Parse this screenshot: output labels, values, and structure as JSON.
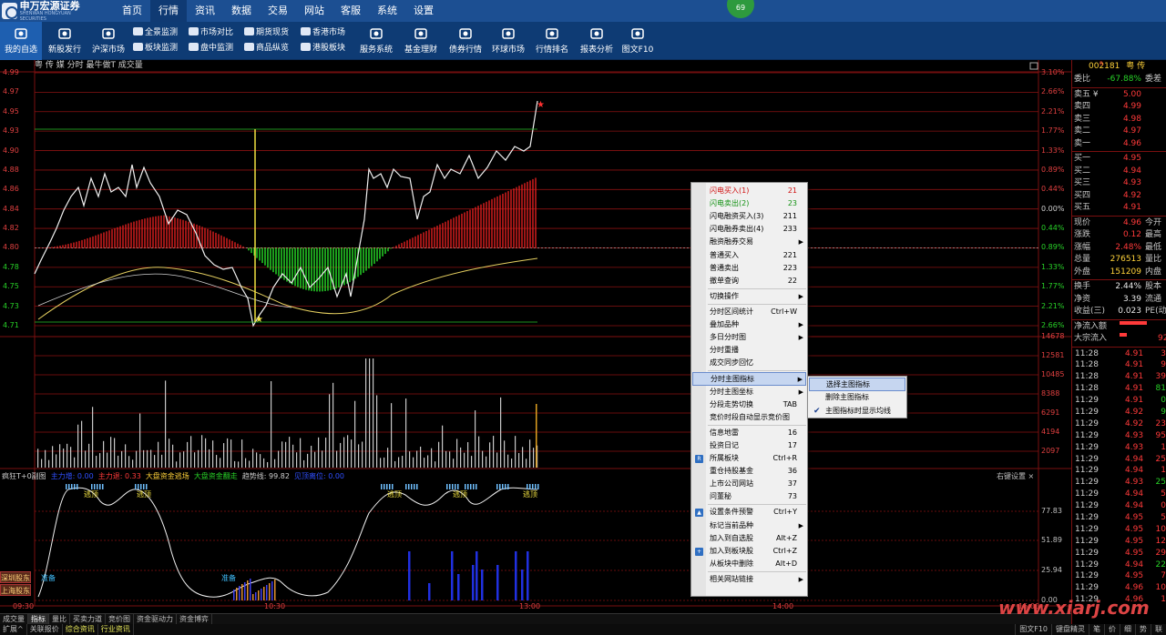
{
  "app": {
    "logo_text": "申万宏源证券",
    "logo_sub": "SHENWAN HONGYUAN SECURITIES",
    "notification_count": "69"
  },
  "menu": [
    "首页",
    "行情",
    "资讯",
    "数据",
    "交易",
    "网站",
    "客服",
    "系统",
    "设置"
  ],
  "menu_active": "行情",
  "toolbar": {
    "big": [
      {
        "label": "我的自选",
        "icon": "favorites-icon"
      },
      {
        "label": "新股发行",
        "icon": "compass-icon"
      },
      {
        "label": "沪深市场",
        "icon": "trend-icon"
      },
      {
        "label": "期货现货",
        "icon": "futures-icon"
      },
      {
        "label": "服务系统",
        "icon": "briefcase-icon"
      },
      {
        "label": "基金理财",
        "icon": "wallet-icon"
      },
      {
        "label": "债券行情",
        "icon": "bond-icon"
      },
      {
        "label": "环球市场",
        "icon": "globe-icon"
      },
      {
        "label": "行情排名",
        "icon": "camera-icon"
      },
      {
        "label": "报表分析",
        "icon": "report-icon"
      },
      {
        "label": "图文F10",
        "icon": "user-icon"
      }
    ],
    "small": [
      "全景监测",
      "板块监测",
      "市场对比",
      "盘中监测",
      "期货现货",
      "商品纵览",
      "香港市场",
      "港股板块"
    ]
  },
  "chart": {
    "title": "粤 传 媒   分时 最牛做T 成交量",
    "price_ticks": [
      "4.99",
      "4.97",
      "4.95",
      "4.93",
      "4.90",
      "4.88",
      "4.86",
      "4.84",
      "4.82",
      "4.80",
      "4.78",
      "4.75",
      "4.73",
      "4.71"
    ],
    "pct_ticks": [
      "3.10%",
      "2.66%",
      "2.21%",
      "1.77%",
      "1.33%",
      "0.89%",
      "0.44%",
      "0.00%",
      "0.44%",
      "0.89%",
      "1.33%",
      "1.77%",
      "2.21%",
      "2.66%"
    ],
    "vol_ticks": [
      "14678",
      "12581",
      "10485",
      "8388",
      "6291",
      "4194",
      "2097"
    ],
    "sub_ticks": [
      "77.83",
      "51.89",
      "25.94",
      "0.00"
    ],
    "time_labels": [
      "09:30",
      "10:30",
      "13:00",
      "14:00",
      "15:00"
    ],
    "sub_legend": [
      {
        "text": "疯狂T+0副图",
        "color": "#d0d0d0"
      },
      {
        "text": "主力增: 0.00",
        "color": "#2f4fff"
      },
      {
        "text": "主力退: 0.33",
        "color": "#ff3a3a"
      },
      {
        "text": "大盘资金逃场",
        "color": "#ffd23a"
      },
      {
        "text": "大盘资金翻走",
        "color": "#28d228"
      },
      {
        "text": "趋势线: 99.82",
        "color": "#d0d0d0"
      },
      {
        "text": "见顶离位: 0.00",
        "color": "#2f4fff"
      }
    ],
    "sub_right": "右键设置 ×",
    "annotations": [
      "逃顶",
      "逃顶",
      "逃顶",
      "逃顶",
      "逃顶",
      "准备",
      "准备"
    ],
    "side_tags": [
      "深圳股东",
      "上海股东"
    ]
  },
  "chart_data": {
    "type": "line",
    "title": "粤 传 媒   分时 最牛做T 成交量",
    "x": [
      "09:30",
      "10:30",
      "13:00",
      "14:00",
      "15:00"
    ],
    "series": [
      {
        "name": "分时",
        "values": [
          4.78,
          4.88,
          4.72,
          4.87,
          4.8,
          4.92,
          4.96
        ]
      }
    ],
    "ylim": [
      4.71,
      4.99
    ],
    "grid": true
  },
  "bottom_tabs": [
    "成交量",
    "指标",
    "量比",
    "买卖力道",
    "竞价图",
    "资金驱动力",
    "资金博弈"
  ],
  "bottom_tabs_active": "指标",
  "bottom_tabs2": [
    "扩展^",
    "关联报价",
    "综合资讯",
    "行业资讯"
  ],
  "status_right": [
    "图文F10",
    "键盘精灵",
    "笔",
    "价",
    "细",
    "势",
    "联"
  ],
  "quote": {
    "code": "002181",
    "name": "粤 传",
    "rows_ratio": {
      "label": "委比",
      "value": "-67.88%",
      "right": "委差"
    },
    "sell": [
      {
        "label": "卖五 ¥",
        "price": "5.00"
      },
      {
        "label": "卖四",
        "price": "4.99"
      },
      {
        "label": "卖三",
        "price": "4.98"
      },
      {
        "label": "卖二",
        "price": "4.97"
      },
      {
        "label": "卖一",
        "price": "4.96"
      }
    ],
    "buy": [
      {
        "label": "买一",
        "price": "4.95"
      },
      {
        "label": "买二",
        "price": "4.94"
      },
      {
        "label": "买三",
        "price": "4.93"
      },
      {
        "label": "买四",
        "price": "4.92"
      },
      {
        "label": "买五",
        "price": "4.91"
      }
    ],
    "stats": [
      {
        "label": "现价",
        "value": "4.96",
        "right": "今开",
        "vc": "red"
      },
      {
        "label": "涨跌",
        "value": "0.12",
        "right": "最高",
        "vc": "red"
      },
      {
        "label": "涨幅",
        "value": "2.48%",
        "right": "最低",
        "vc": "red"
      },
      {
        "label": "总量",
        "value": "276513",
        "right": "量比",
        "vc": "yel"
      },
      {
        "label": "外盘",
        "value": "151209",
        "right": "内盘",
        "vc": "yel"
      }
    ],
    "stats2": [
      {
        "label": "换手",
        "value": "2.44%",
        "right": "股本",
        "vc": "wht"
      },
      {
        "label": "净资",
        "value": "3.39",
        "right": "流通",
        "vc": "wht"
      },
      {
        "label": "收益(三)",
        "value": "0.023",
        "right": "PE(动)",
        "vc": "wht"
      }
    ],
    "flows": [
      {
        "label": "净流入额",
        "right": "",
        "fill": 0.75
      },
      {
        "label": "大宗流入",
        "right": "92",
        "fill": 0.2
      }
    ],
    "ticks": [
      {
        "time": "11:28",
        "price": "4.91",
        "vol": "3",
        "vc": "red"
      },
      {
        "time": "11:28",
        "price": "4.91",
        "vol": "9",
        "vc": "red"
      },
      {
        "time": "11:28",
        "price": "4.91",
        "vol": "39",
        "vc": "red"
      },
      {
        "time": "11:28",
        "price": "4.91",
        "vol": "81",
        "vc": "grn"
      },
      {
        "time": "11:29",
        "price": "4.91",
        "vol": "0",
        "vc": "grn"
      },
      {
        "time": "11:29",
        "price": "4.92",
        "vol": "9",
        "vc": "grn"
      },
      {
        "time": "11:29",
        "price": "4.92",
        "vol": "23",
        "vc": "red"
      },
      {
        "time": "11:29",
        "price": "4.93",
        "vol": "95",
        "vc": "red"
      },
      {
        "time": "11:29",
        "price": "4.93",
        "vol": "1",
        "vc": "red"
      },
      {
        "time": "11:29",
        "price": "4.94",
        "vol": "25",
        "vc": "red"
      },
      {
        "time": "11:29",
        "price": "4.94",
        "vol": "1",
        "vc": "red"
      },
      {
        "time": "11:29",
        "price": "4.93",
        "vol": "25",
        "vc": "grn"
      },
      {
        "time": "11:29",
        "price": "4.94",
        "vol": "5",
        "vc": "red"
      },
      {
        "time": "11:29",
        "price": "4.94",
        "vol": "0",
        "vc": "red"
      },
      {
        "time": "11:29",
        "price": "4.95",
        "vol": "5",
        "vc": "red"
      },
      {
        "time": "11:29",
        "price": "4.95",
        "vol": "10",
        "vc": "red"
      },
      {
        "time": "11:29",
        "price": "4.95",
        "vol": "12",
        "vc": "red"
      },
      {
        "time": "11:29",
        "price": "4.95",
        "vol": "29",
        "vc": "red"
      },
      {
        "time": "11:29",
        "price": "4.94",
        "vol": "22",
        "vc": "grn"
      },
      {
        "time": "11:29",
        "price": "4.95",
        "vol": "7",
        "vc": "red"
      },
      {
        "time": "11:29",
        "price": "4.96",
        "vol": "10",
        "vc": "red"
      },
      {
        "time": "11:29",
        "price": "4.96",
        "vol": "1",
        "vc": "red"
      }
    ]
  },
  "context_menu": {
    "items": [
      {
        "label": "闪电买入(1)",
        "shortcut": "21",
        "style": "red-t"
      },
      {
        "label": "闪电卖出(2)",
        "shortcut": "23",
        "style": "grn-t"
      },
      {
        "label": "闪电融资买入(3)",
        "shortcut": "211"
      },
      {
        "label": "闪电融券卖出(4)",
        "shortcut": "233"
      },
      {
        "label": "融资融券交易",
        "arrow": true
      },
      {
        "label": "普通买入",
        "shortcut": "221"
      },
      {
        "label": "普通卖出",
        "shortcut": "223"
      },
      {
        "label": "撤单查询",
        "shortcut": "22"
      },
      {
        "sep": true
      },
      {
        "label": "切换操作",
        "arrow": true
      },
      {
        "sep": true
      },
      {
        "label": "分时区间统计",
        "shortcut": "Ctrl+W"
      },
      {
        "label": "叠加品种",
        "arrow": true
      },
      {
        "label": "多日分时图",
        "arrow": true
      },
      {
        "label": "分时重播"
      },
      {
        "label": "成交同步回忆"
      },
      {
        "sep": true
      },
      {
        "label": "分时主图指标",
        "arrow": true,
        "hover": true
      },
      {
        "label": "分时主图坐标",
        "arrow": true
      },
      {
        "label": "分段走势切换",
        "shortcut": "TAB"
      },
      {
        "label": "竞价时段自动显示竞价图"
      },
      {
        "sep": true
      },
      {
        "label": "信息地雷",
        "shortcut": "16"
      },
      {
        "label": "投资日记",
        "shortcut": "17"
      },
      {
        "label": "所属板块",
        "shortcut": "Ctrl+R",
        "icon": "R"
      },
      {
        "label": "重仓持股基金",
        "shortcut": "36"
      },
      {
        "label": "上市公司网站",
        "shortcut": "37"
      },
      {
        "label": "问董秘",
        "shortcut": "73"
      },
      {
        "sep": true
      },
      {
        "label": "设置条件预警",
        "shortcut": "Ctrl+Y",
        "icon": "▲"
      },
      {
        "label": "标记当前品种",
        "arrow": true
      },
      {
        "label": "加入到自选股",
        "shortcut": "Alt+Z"
      },
      {
        "label": "加入到板块股",
        "shortcut": "Ctrl+Z",
        "icon": "+"
      },
      {
        "label": "从板块中删除",
        "shortcut": "Alt+D"
      },
      {
        "sep": true
      },
      {
        "label": "相关网站链接",
        "arrow": true
      }
    ]
  },
  "submenu": {
    "items": [
      {
        "label": "选择主图指标",
        "hover": true
      },
      {
        "label": "删除主图指标"
      },
      {
        "label": "主图指标时显示均线",
        "checked": true
      }
    ]
  },
  "watermark": "www.xiarj.com"
}
